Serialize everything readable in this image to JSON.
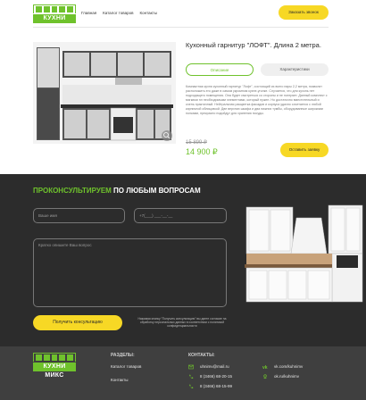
{
  "header": {
    "logo_text": "КУХНИ МИКС",
    "nav": [
      "Главная",
      "Каталог товаров",
      "Контакты"
    ],
    "call_button": "Заказать звонок"
  },
  "product": {
    "title": "Кухонный гарнитур \"ЛОФТ\". Длина 2 метра.",
    "tabs": [
      "Описание",
      "Характеристики"
    ],
    "description": "Компактная кухня кухонный гарнитур \"Лофт\", состоящий из всего пары 2,2 метра, позволит расположить его даже в самом укромном кухне-уголке. Случается, что для кухонь нет подходящего помещения. Она будет смотреться со стороны и не потеряет. Данный комплект с мягкими пл необходимыми элементами, который нужен. Но достаточно вместительный и очень практичный. Нейтральная расцветка фасадов и корпуса удачно сочетается с любой кирпичной облицовкой. Две верхних шкафа и два нижних тумбы, оборудованные широкими полками, прекрасно подойдут для хранения посуды.",
    "old_price": "15 899 ₽",
    "price": "14 900 ₽",
    "order_button": "Оставить заявку"
  },
  "consult": {
    "title_accent": "ПРОКОНСУЛЬТИРУЕМ",
    "title_rest": " ПО ЛЮБЫМ ВОПРОСАМ",
    "name_placeholder": "Ваше имя",
    "phone_placeholder": "+7(___) ___-__-__",
    "question_placeholder": "Кратко опишите Ваш вопрос",
    "submit_button": "Получить консультацию",
    "consent_text": "Нажимая кнопку \"Получить консультацию\" вы даете согласие на обработку персональных данных в соответствии с политикой конфиденциальности"
  },
  "footer": {
    "logo_text": "КУХНИ МИКС",
    "sections_heading": "РАЗДЕЛЫ:",
    "sections": [
      "Каталог товаров",
      "Контакты"
    ],
    "contacts_heading": "КОНТАКТЫ:",
    "email": "uhnimv@mail.ru",
    "phone1": "8 (3466) 68-20-15",
    "phone2": "8 (3466) 68-15-99",
    "vk": "vk.com/kuhnimv",
    "ok": "ok.ru/kuhnimv"
  },
  "colors": {
    "accent": "#6fc22c",
    "button": "#f7d825",
    "dark": "#2c2c2c",
    "footer": "#3f3f3f"
  },
  "icons": [
    "mail-icon",
    "phone-icon",
    "vk-icon",
    "ok-icon",
    "zoom-icon"
  ]
}
